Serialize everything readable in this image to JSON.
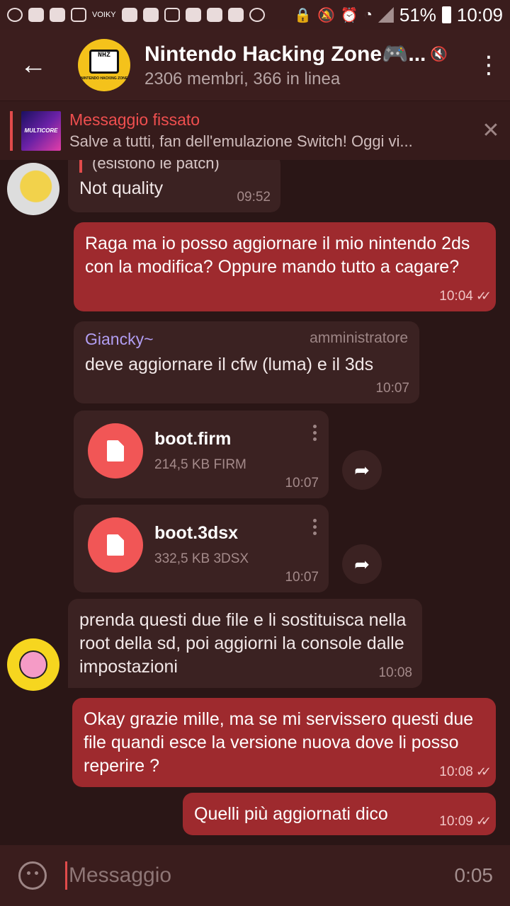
{
  "status_bar": {
    "battery": "51%",
    "clock": "10:09",
    "carrier_tag": "VOIKY"
  },
  "header": {
    "back_icon": "arrow-left-icon",
    "avatar_text": "NHZ",
    "avatar_subtext": "NINTENDO HACKING ZONE",
    "title": "Nintendo Hacking Zone🎮...",
    "subtitle": "2306 membri, 366 in linea",
    "menu_icon": "more-vertical-icon"
  },
  "pinned": {
    "label": "Messaggio fissato",
    "text": "Salve a tutti, fan dell'emulazione Switch! Oggi vi...",
    "thumb_text": "MULTICORE"
  },
  "messages": {
    "m1": {
      "reply": "(esistono le patch)",
      "text": "Not quality",
      "time": "09:52"
    },
    "m2": {
      "text": "Raga ma io posso aggiornare il mio nintendo 2ds con la modifica? Oppure mando tutto a cagare?",
      "time": "10:04"
    },
    "m3": {
      "sender": "Giancky~",
      "role": "amministratore",
      "text": "deve aggiornare il cfw (luma) e il 3ds",
      "time": "10:07"
    },
    "f1": {
      "name": "boot.firm",
      "meta": "214,5 KB FIRM",
      "time": "10:07"
    },
    "f2": {
      "name": "boot.3dsx",
      "meta": "332,5 KB 3DSX",
      "time": "10:07"
    },
    "m4": {
      "text": "prenda questi due file e li sostituisca nella root della sd, poi aggiorni la console dalle impostazioni",
      "time": "10:08"
    },
    "m5": {
      "text": "Okay grazie mille, ma se mi servissero questi due file quandi esce la versione nuova dove li posso reperire ?",
      "time": "10:08"
    },
    "m6": {
      "text": "Quelli più aggiornati dico",
      "time": "10:09"
    }
  },
  "input": {
    "placeholder": "Messaggio",
    "record_time": "0:05"
  }
}
